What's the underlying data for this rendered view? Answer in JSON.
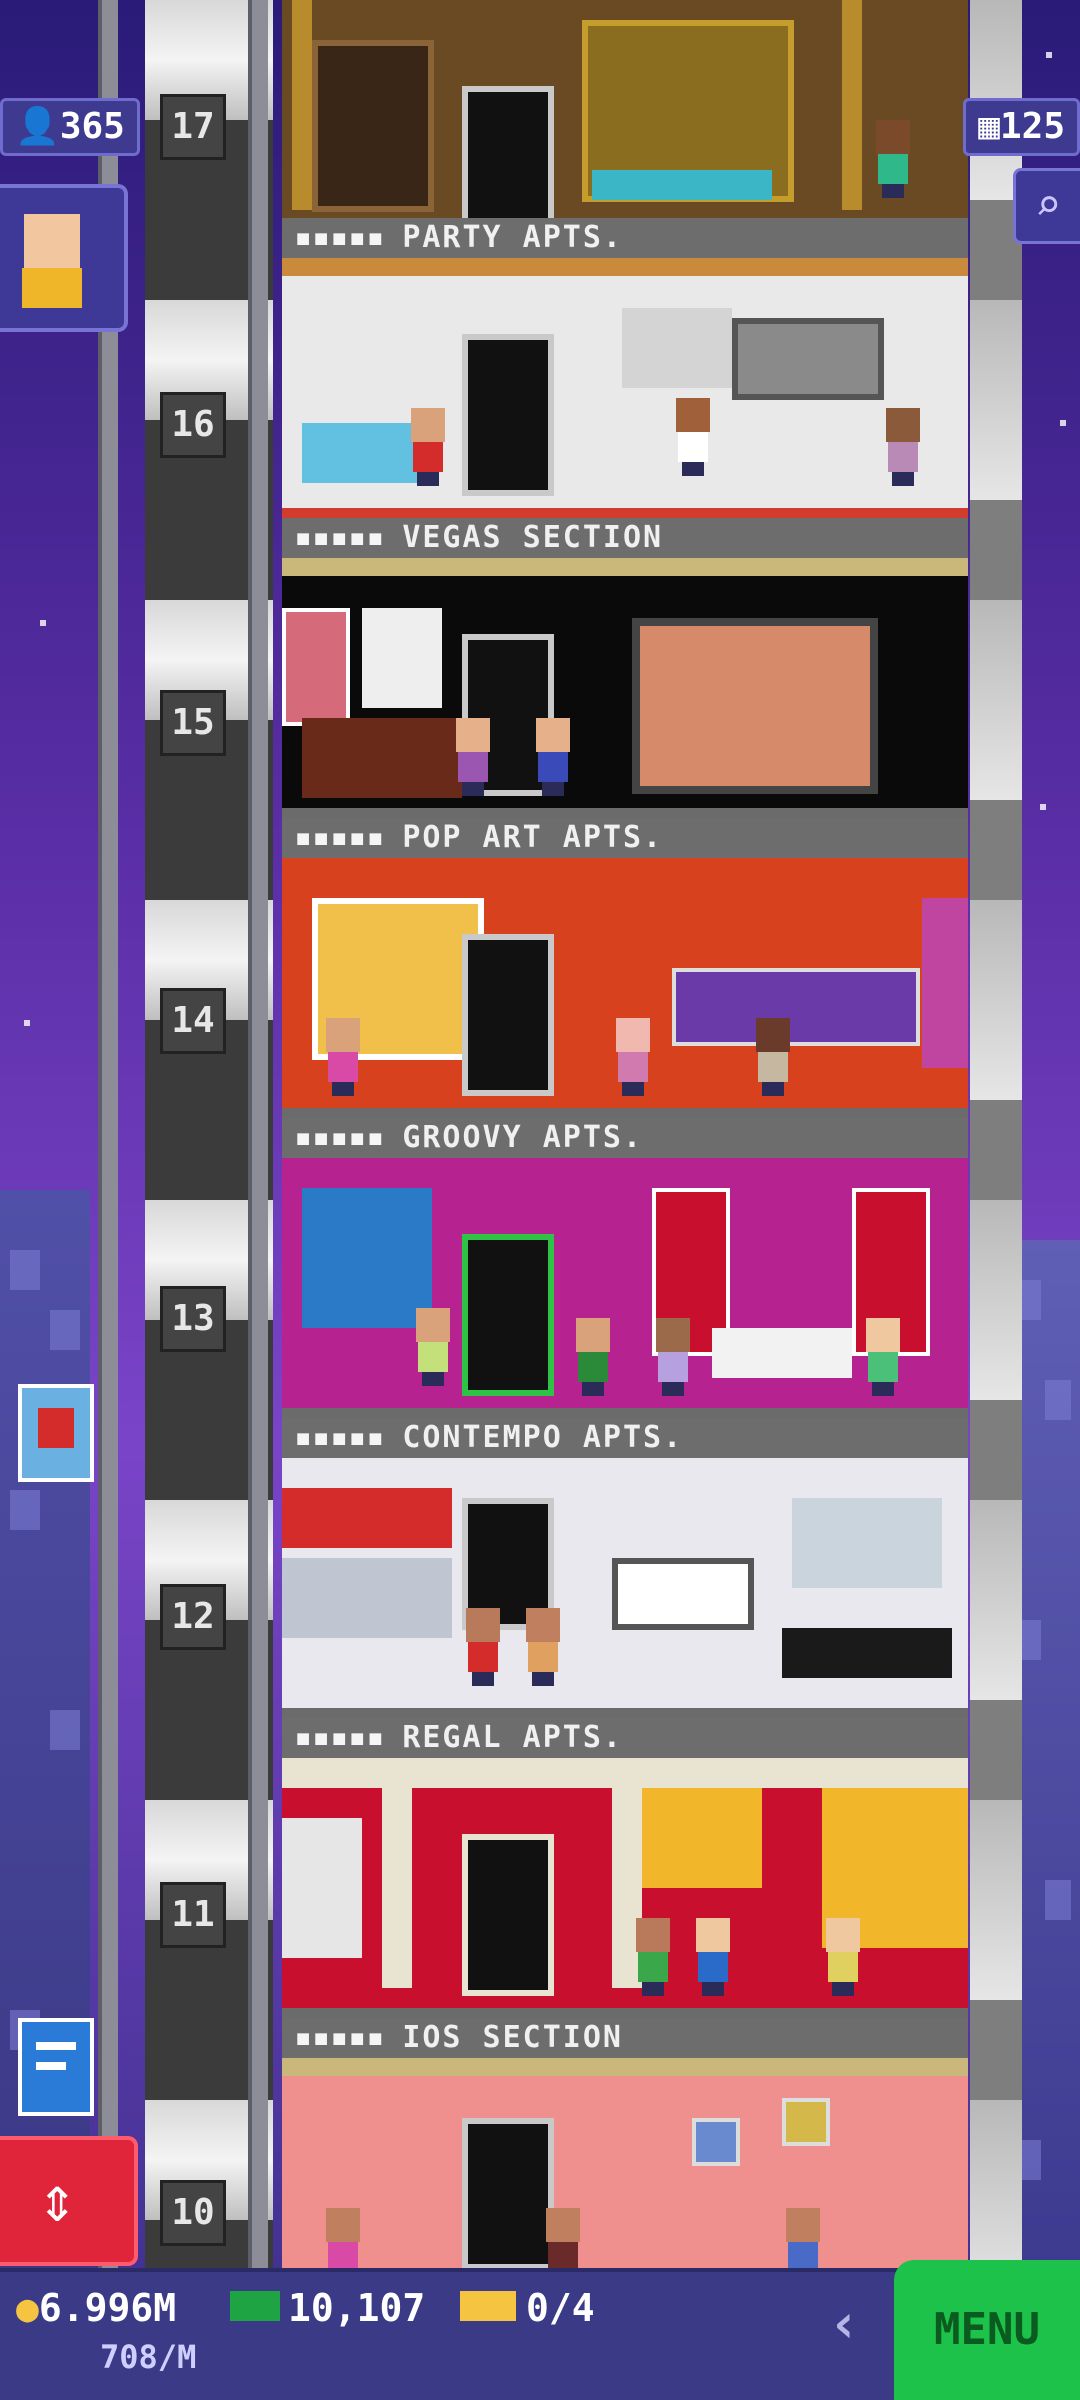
{
  "header": {
    "population": "365",
    "bux_buildings": "125"
  },
  "floors": [
    {
      "number": "17",
      "label_dots": "▪▪▪▪▪",
      "label": "PARTY APTS."
    },
    {
      "number": "16",
      "label_dots": "▪▪▪▪▪",
      "label": "VEGAS SECTION"
    },
    {
      "number": "15",
      "label_dots": "▪▪▪▪▪",
      "label": "POP ART APTS."
    },
    {
      "number": "14",
      "label_dots": "▪▪▪▪▪",
      "label": "GROOVY APTS."
    },
    {
      "number": "13",
      "label_dots": "▪▪▪▪▪",
      "label": "CONTEMPO APTS."
    },
    {
      "number": "12",
      "label_dots": "▪▪▪▪▪",
      "label": "REGAL APTS."
    },
    {
      "number": "11",
      "label_dots": "▪▪▪▪▪",
      "label": "IOS SECTION"
    },
    {
      "number": "10",
      "label_dots": "",
      "label": ""
    }
  ],
  "bottom_bar": {
    "coins": "6.996M",
    "coins_rate": "708/M",
    "bux": "10,107",
    "tickets": "0/4",
    "menu_label": "MENU"
  },
  "icons": {
    "search": "magnifier-icon",
    "population": "person-icon",
    "buildings": "building-icon",
    "elevator": "elevator-arrows-icon",
    "back": "chevron-left-icon"
  },
  "colors": {
    "sky": "#5a2ea6",
    "menu_green": "#1cc24a",
    "elevator_red": "#e0253a",
    "label_gray": "#6d6d6d"
  }
}
